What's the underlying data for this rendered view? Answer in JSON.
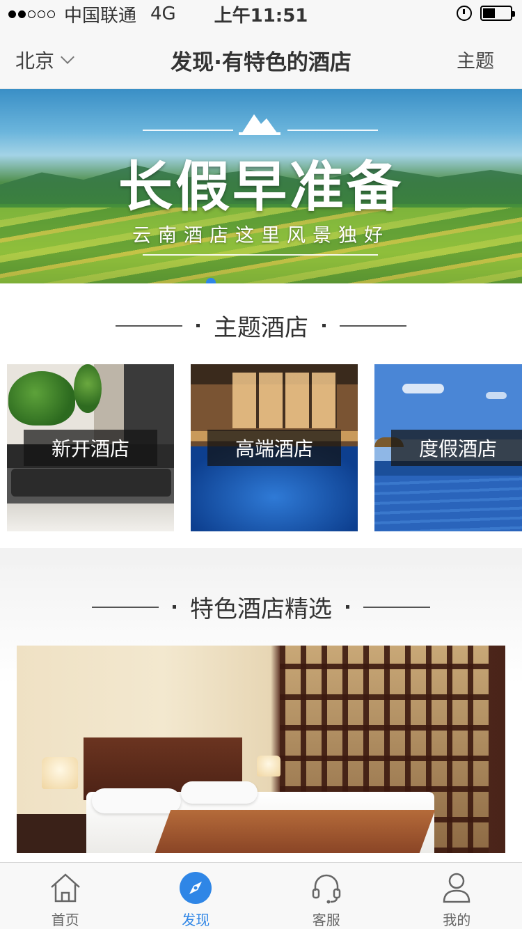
{
  "status_bar": {
    "carrier": "中国联通",
    "network": "4G",
    "time": "上午11:51"
  },
  "nav": {
    "city": "北京",
    "title": "发现·有特色的酒店",
    "right_label": "主题"
  },
  "banner": {
    "title": "长假早准备",
    "subtitle": "云南酒店这里风景独好",
    "active_indicator_color": "#2f86e6"
  },
  "theme_section": {
    "heading": "主题酒店",
    "cards": [
      {
        "label": "新开酒店"
      },
      {
        "label": "高端酒店"
      },
      {
        "label": "度假酒店"
      }
    ]
  },
  "featured_section": {
    "heading": "特色酒店精选"
  },
  "tab_bar": {
    "active_color": "#2f86e6",
    "items": [
      {
        "label": "首页",
        "icon": "home-icon"
      },
      {
        "label": "发现",
        "icon": "compass-icon"
      },
      {
        "label": "客服",
        "icon": "headset-icon"
      },
      {
        "label": "我的",
        "icon": "user-icon"
      }
    ]
  }
}
